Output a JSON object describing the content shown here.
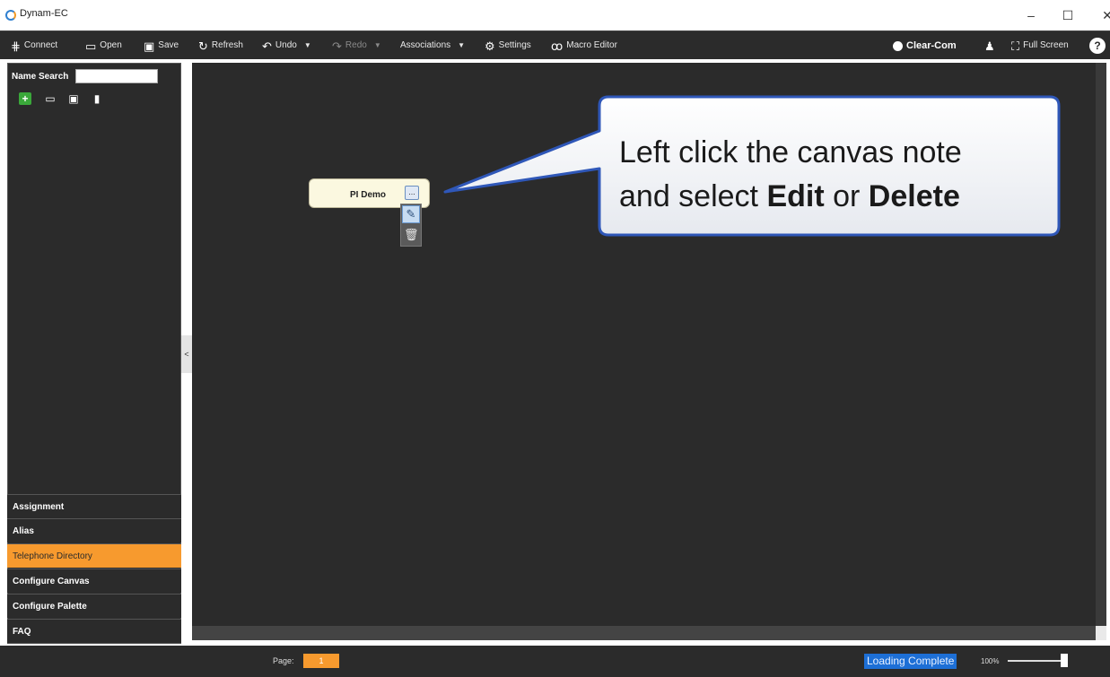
{
  "window": {
    "title": "Dynam-EC",
    "minimize": "–",
    "maximize": "☐",
    "close": "✕"
  },
  "toolbar": {
    "connect": "Connect",
    "open": "Open",
    "save": "Save",
    "refresh": "Refresh",
    "undo": "Undo",
    "redo": "Redo",
    "associations": "Associations",
    "settings": "Settings",
    "macro_editor": "Macro Editor",
    "brand": "Clear-Com",
    "full_screen": "Full Screen",
    "help": "?"
  },
  "left_panel": {
    "name_search_label": "Name Search",
    "name_search_value": "",
    "collapse_handle": "<",
    "nav_items": [
      {
        "label": "Assignment",
        "active": false
      },
      {
        "label": "Alias",
        "active": false
      },
      {
        "label": "Telephone Directory",
        "active": true
      },
      {
        "label": "Configure Canvas",
        "active": false
      },
      {
        "label": "Configure Palette",
        "active": false
      },
      {
        "label": "FAQ",
        "active": false
      }
    ]
  },
  "canvas": {
    "note_title": "PI Demo",
    "note_menu": "..."
  },
  "callout": {
    "line1": "Left click the canvas note",
    "line2_prefix": "and select ",
    "edit_word": "Edit",
    "or_word": " or ",
    "delete_word": "Delete"
  },
  "status": {
    "page_label": "Page:",
    "page_value": "1",
    "loading": "Loading Complete",
    "zoom": "100%"
  },
  "colors": {
    "panel_bg": "#2b2b2b",
    "accent_orange": "#f79a2e",
    "status_blue": "#1d6fd6",
    "callout_border": "#2f57b8"
  }
}
